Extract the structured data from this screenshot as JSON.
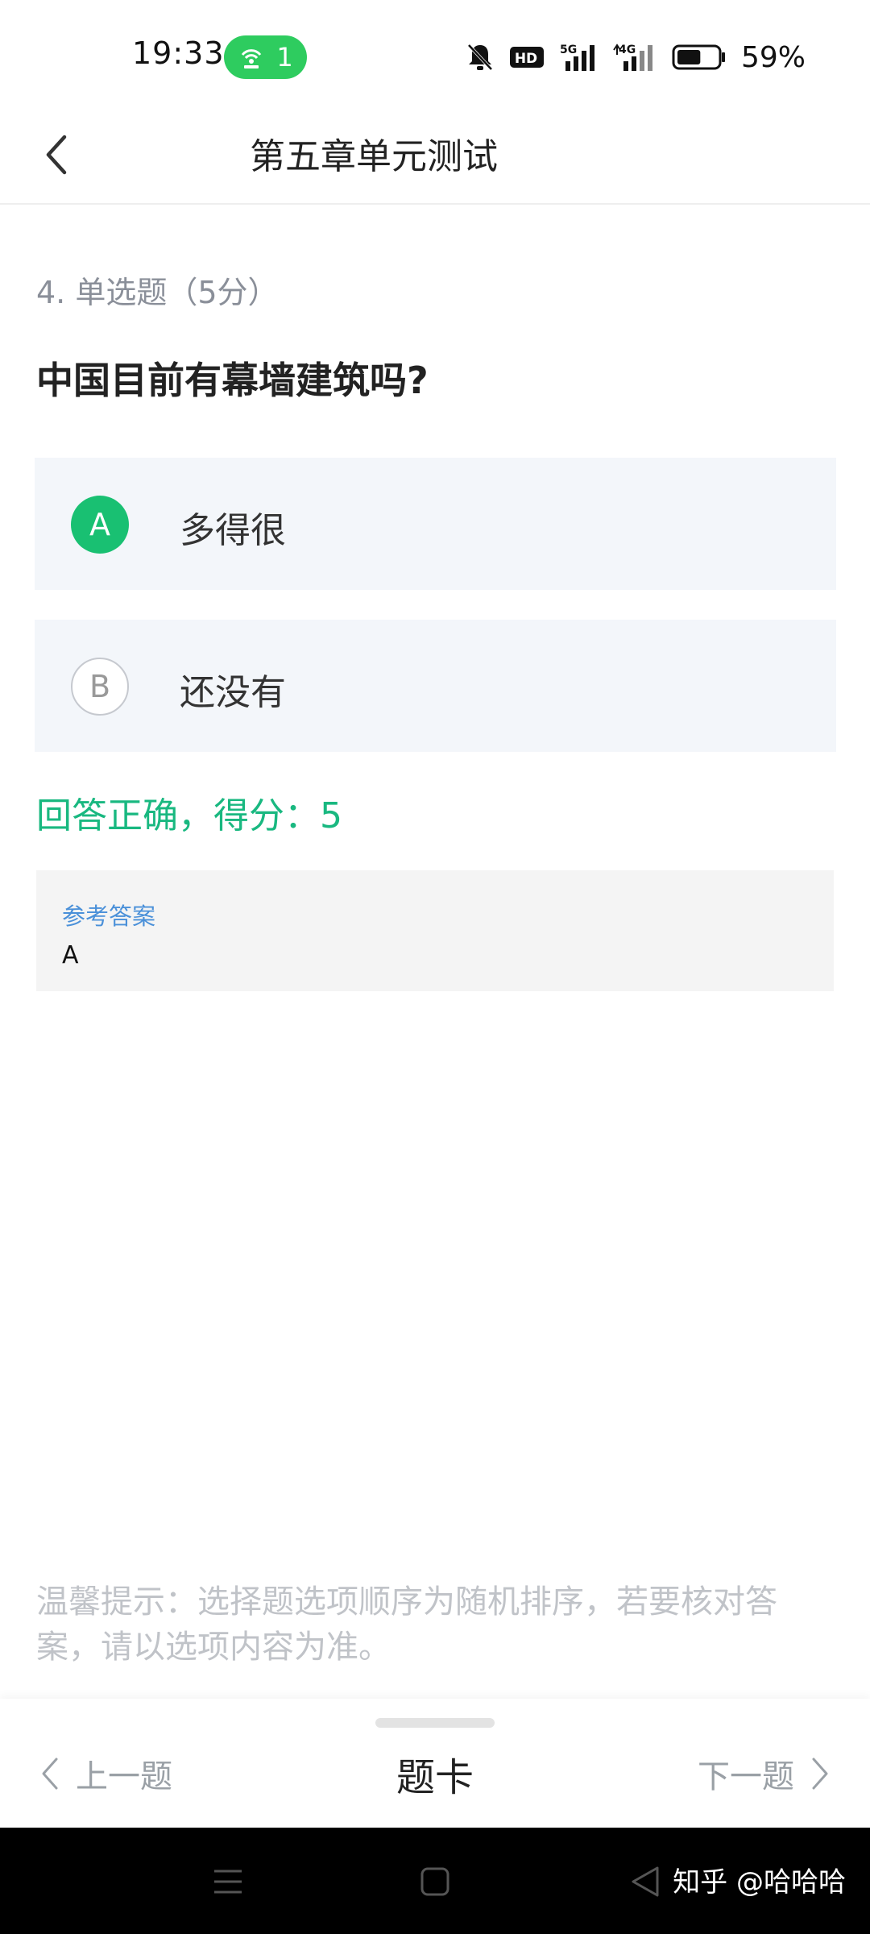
{
  "status_bar": {
    "time": "19:33",
    "hotspot_count": "1",
    "hd_label": "HD",
    "net1": "5G",
    "net2": "4G",
    "battery_pct": "59%",
    "battery_level": 0.59
  },
  "header": {
    "title": "第五章单元测试"
  },
  "question": {
    "meta": "4. 单选题（5分）",
    "text": "中国目前有幕墙建筑吗?",
    "options": [
      {
        "letter": "A",
        "text": "多得很",
        "selected": true
      },
      {
        "letter": "B",
        "text": "还没有",
        "selected": false
      }
    ],
    "result": "回答正确，得分：5"
  },
  "reference": {
    "label": "参考答案",
    "answer": "A"
  },
  "tip": "温馨提示：选择题选项顺序为随机排序，若要核对答案，请以选项内容为准。",
  "bottom_nav": {
    "prev": "上一题",
    "card": "题卡",
    "next": "下一题"
  },
  "watermark": "知乎 @哈哈哈",
  "colors": {
    "accent_green": "#19c072",
    "result_green": "#19b880",
    "link_blue": "#4a90d9",
    "hotspot_green": "#2ecc5f"
  }
}
